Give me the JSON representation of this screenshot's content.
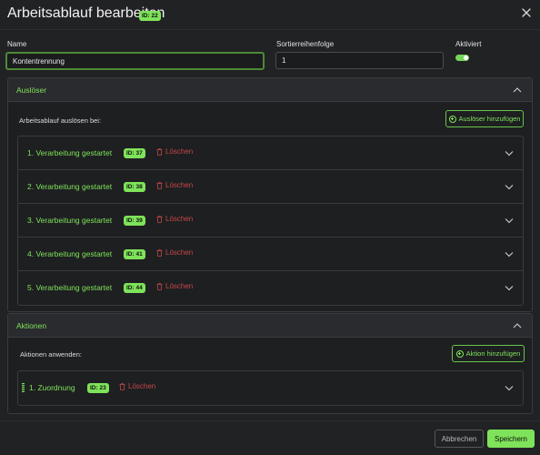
{
  "dialog": {
    "title": "Arbeitsablauf bearbeiten",
    "id_badge": "ID: 22"
  },
  "form": {
    "name_label": "Name",
    "name_value": "Kontentrennung",
    "sort_label": "Sortierreihenfolge",
    "sort_value": "1",
    "active_label": "Aktiviert",
    "active": true
  },
  "triggers": {
    "title": "Auslöser",
    "sub_label": "Arbeitsablauf auslösen bei:",
    "add_label": "Auslöser hinzufügen",
    "items": [
      {
        "label": "1. Verarbeitung gestartet",
        "id": "ID: 37",
        "delete": "Löschen"
      },
      {
        "label": "2. Verarbeitung gestartet",
        "id": "ID: 38",
        "delete": "Löschen"
      },
      {
        "label": "3. Verarbeitung gestartet",
        "id": "ID: 39",
        "delete": "Löschen"
      },
      {
        "label": "4. Verarbeitung gestartet",
        "id": "ID: 41",
        "delete": "Löschen"
      },
      {
        "label": "5. Verarbeitung gestartet",
        "id": "ID: 44",
        "delete": "Löschen"
      }
    ]
  },
  "actions": {
    "title": "Aktionen",
    "sub_label": "Aktionen anwenden:",
    "add_label": "Aktion hinzufügen",
    "items": [
      {
        "label": "1. Zuordnung",
        "id": "ID: 23",
        "delete": "Löschen"
      }
    ]
  },
  "footer": {
    "cancel_label": "Abbrechen",
    "save_label": "Speichern"
  },
  "colors": {
    "accent": "#7ee35a",
    "danger": "#c54848",
    "background": "#212224"
  }
}
